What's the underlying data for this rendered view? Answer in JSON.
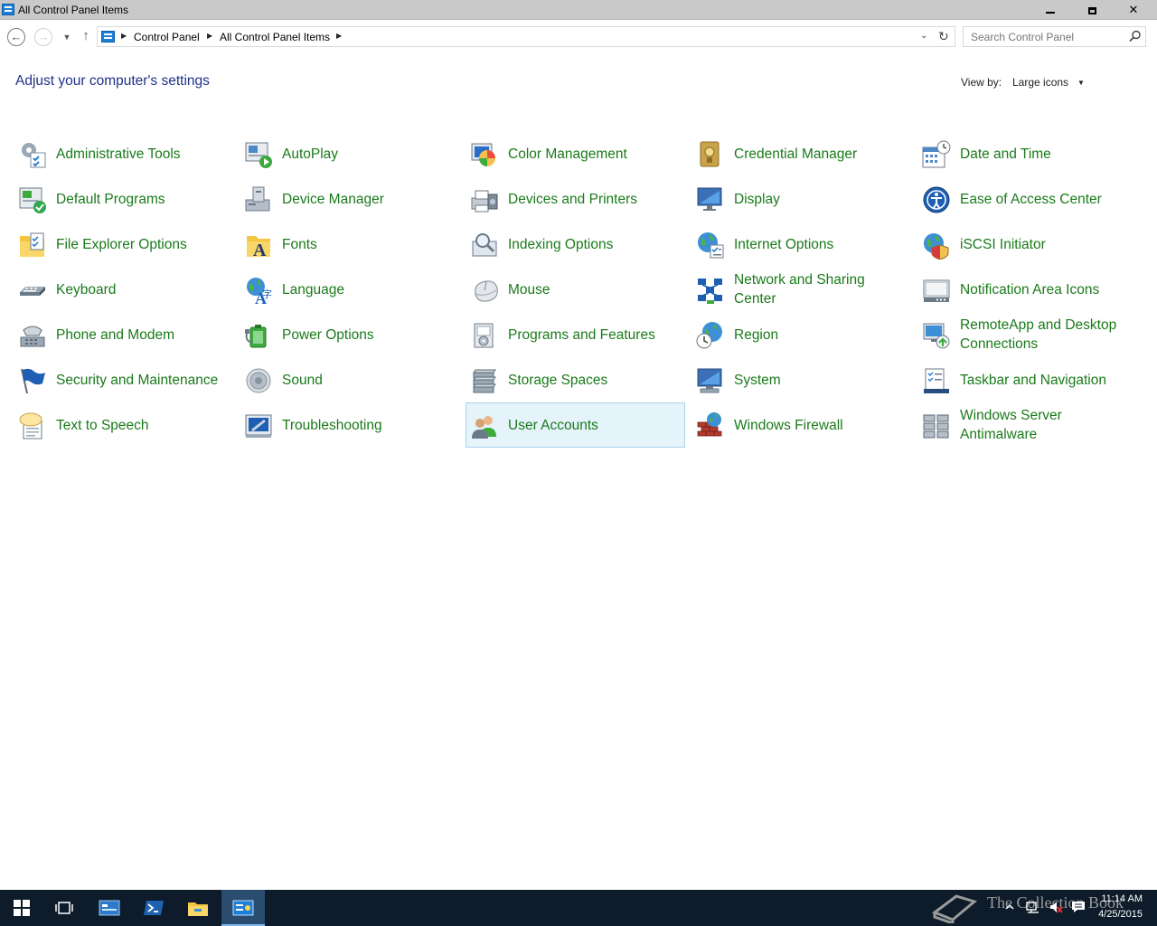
{
  "window": {
    "title": "All Control Panel Items"
  },
  "nav": {
    "breadcrumbs": [
      "Control Panel",
      "All Control Panel Items"
    ],
    "search_placeholder": "Search Control Panel"
  },
  "header": {
    "heading": "Adjust your computer's settings",
    "view_by_label": "View by:",
    "view_by_value": "Large icons"
  },
  "items": [
    {
      "label": "Administrative Tools",
      "icon": "admin-tools-icon"
    },
    {
      "label": "AutoPlay",
      "icon": "autoplay-icon"
    },
    {
      "label": "Color Management",
      "icon": "color-management-icon"
    },
    {
      "label": "Credential Manager",
      "icon": "credential-manager-icon"
    },
    {
      "label": "Date and Time",
      "icon": "date-time-icon"
    },
    {
      "label": "Default Programs",
      "icon": "default-programs-icon"
    },
    {
      "label": "Device Manager",
      "icon": "device-manager-icon"
    },
    {
      "label": "Devices and Printers",
      "icon": "devices-printers-icon"
    },
    {
      "label": "Display",
      "icon": "display-icon"
    },
    {
      "label": "Ease of Access Center",
      "icon": "ease-of-access-icon"
    },
    {
      "label": "File Explorer Options",
      "icon": "file-explorer-options-icon"
    },
    {
      "label": "Fonts",
      "icon": "fonts-icon"
    },
    {
      "label": "Indexing Options",
      "icon": "indexing-options-icon"
    },
    {
      "label": "Internet Options",
      "icon": "internet-options-icon"
    },
    {
      "label": "iSCSI Initiator",
      "icon": "iscsi-initiator-icon"
    },
    {
      "label": "Keyboard",
      "icon": "keyboard-icon"
    },
    {
      "label": "Language",
      "icon": "language-icon"
    },
    {
      "label": "Mouse",
      "icon": "mouse-icon"
    },
    {
      "label": "Network and Sharing Center",
      "icon": "network-sharing-icon"
    },
    {
      "label": "Notification Area Icons",
      "icon": "notification-area-icon"
    },
    {
      "label": "Phone and Modem",
      "icon": "phone-modem-icon"
    },
    {
      "label": "Power Options",
      "icon": "power-options-icon"
    },
    {
      "label": "Programs and Features",
      "icon": "programs-features-icon"
    },
    {
      "label": "Region",
      "icon": "region-icon"
    },
    {
      "label": "RemoteApp and Desktop Connections",
      "icon": "remoteapp-icon"
    },
    {
      "label": "Security and Maintenance",
      "icon": "security-maintenance-icon"
    },
    {
      "label": "Sound",
      "icon": "sound-icon"
    },
    {
      "label": "Storage Spaces",
      "icon": "storage-spaces-icon"
    },
    {
      "label": "System",
      "icon": "system-icon"
    },
    {
      "label": "Taskbar and Navigation",
      "icon": "taskbar-navigation-icon"
    },
    {
      "label": "Text to Speech",
      "icon": "text-to-speech-icon"
    },
    {
      "label": "Troubleshooting",
      "icon": "troubleshooting-icon"
    },
    {
      "label": "User Accounts",
      "icon": "user-accounts-icon",
      "selected": true
    },
    {
      "label": "Windows Firewall",
      "icon": "windows-firewall-icon"
    },
    {
      "label": "Windows Server Antimalware",
      "icon": "antimalware-icon"
    }
  ],
  "taskbar": {
    "watermark": "The Collection Book",
    "time": "11:14 AM",
    "date": "4/25/2015"
  },
  "colors": {
    "item_text": "#1a7a1a",
    "heading": "#1e3287",
    "selection_bg": "#e5f3fb",
    "selection_border": "#a8d3ef",
    "taskbar_bg": "#0d1b2a"
  }
}
